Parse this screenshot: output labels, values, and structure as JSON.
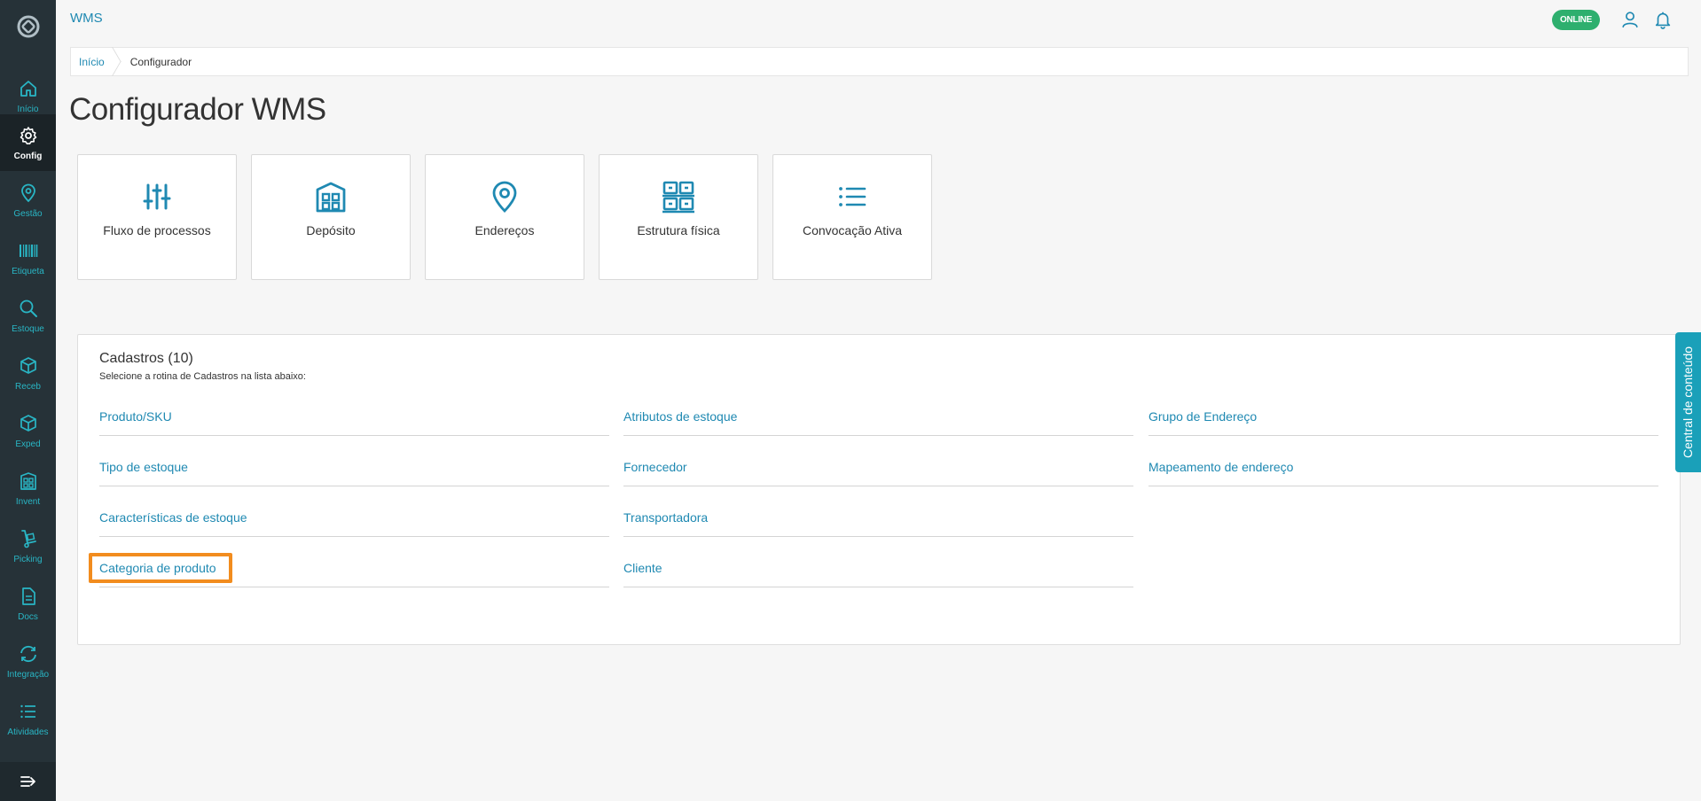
{
  "app": {
    "title": "WMS",
    "status": "ONLINE"
  },
  "colors": {
    "accent": "#1f89b2",
    "sidebar": "#263238",
    "online": "#2eaf6e",
    "highlight": "#f28c1e",
    "side_tab": "#1aa0b9"
  },
  "sidebar": {
    "items": [
      {
        "label": "Início",
        "icon": "home-icon"
      },
      {
        "label": "Config",
        "icon": "gear-icon",
        "active": true
      },
      {
        "label": "Gestão",
        "icon": "location-pin-icon"
      },
      {
        "label": "Etiqueta",
        "icon": "barcode-icon"
      },
      {
        "label": "Estoque",
        "icon": "search-icon"
      },
      {
        "label": "Receb",
        "icon": "box-in-icon"
      },
      {
        "label": "Exped",
        "icon": "box-out-icon"
      },
      {
        "label": "Invent",
        "icon": "building-icon"
      },
      {
        "label": "Picking",
        "icon": "hand-truck-icon"
      },
      {
        "label": "Docs",
        "icon": "document-icon"
      },
      {
        "label": "Integração",
        "icon": "sync-icon"
      },
      {
        "label": "Atividades",
        "icon": "list-icon"
      }
    ]
  },
  "breadcrumb": {
    "home": "Início",
    "current": "Configurador"
  },
  "page": {
    "title": "Configurador WMS"
  },
  "cards": [
    {
      "label": "Fluxo de processos",
      "icon": "sliders-icon"
    },
    {
      "label": "Depósito",
      "icon": "warehouse-icon"
    },
    {
      "label": "Endereços",
      "icon": "location-pin-icon"
    },
    {
      "label": "Estrutura física",
      "icon": "shelves-icon"
    },
    {
      "label": "Convocação Ativa",
      "icon": "list-icon"
    }
  ],
  "cadastros": {
    "title": "Cadastros (10)",
    "subtitle": "Selecione a rotina de Cadastros na lista abaixo:",
    "columns": [
      [
        "Produto/SKU",
        "Tipo de estoque",
        "Características de estoque",
        "Categoria de produto"
      ],
      [
        "Atributos de estoque",
        "Fornecedor",
        "Transportadora",
        "Cliente"
      ],
      [
        "Grupo de Endereço",
        "Mapeamento de endereço"
      ]
    ]
  },
  "side_tab": {
    "label": "Central de conteúdo"
  }
}
